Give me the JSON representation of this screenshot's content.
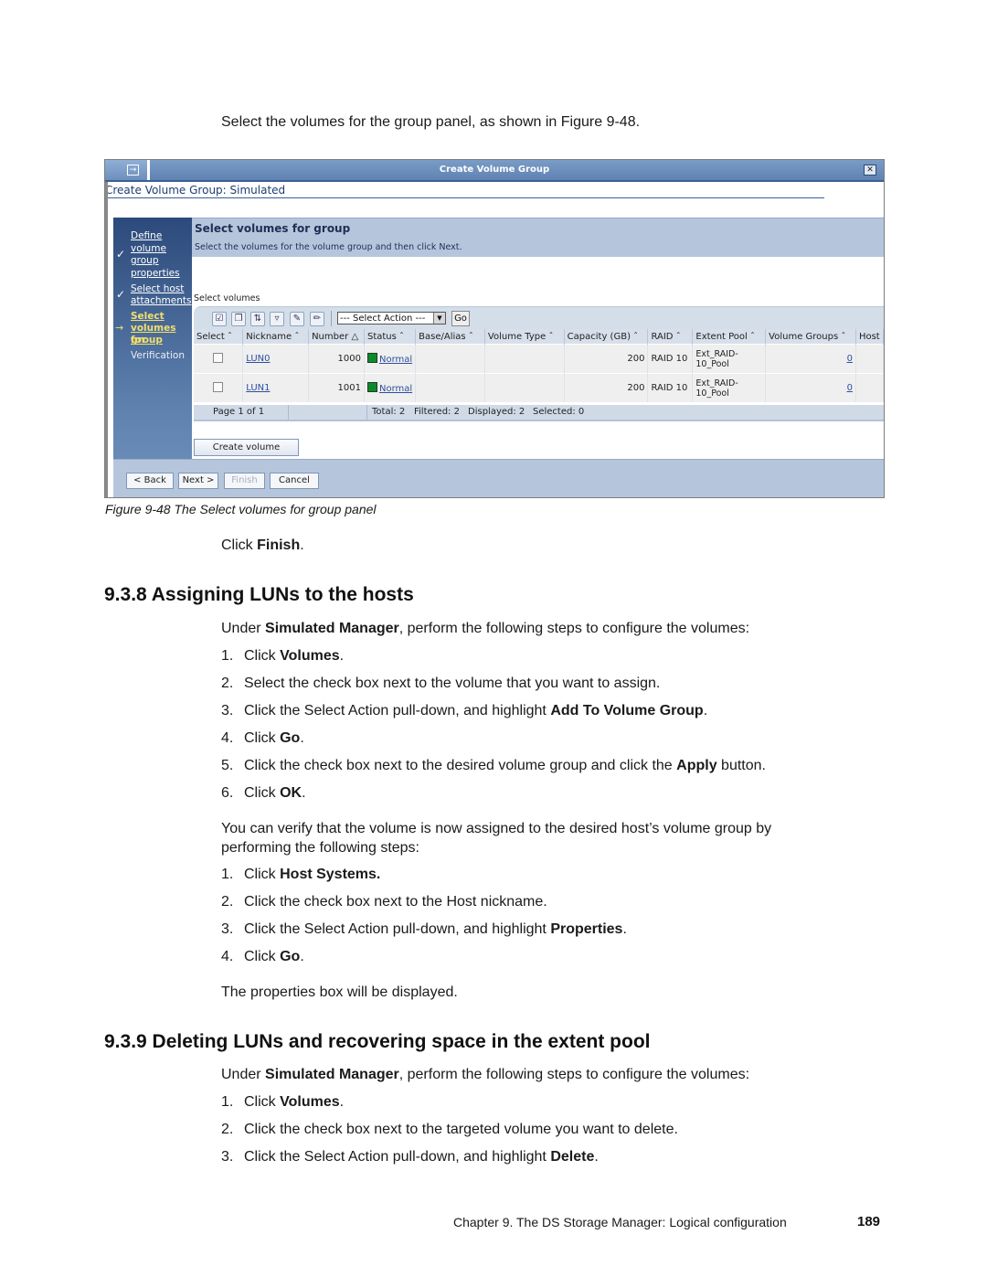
{
  "intro": "Select the volumes for the group panel, as shown in Figure 9-48.",
  "figure": {
    "window_title": "Create Volume Group",
    "wizard_title": "Create Volume Group: Simulated",
    "nav": {
      "step1": [
        "Define",
        "volume",
        "group",
        "properties"
      ],
      "step2": [
        "Select host",
        "attachments"
      ],
      "step3": [
        "Select",
        "volumes for",
        "group"
      ],
      "step4": "Verification"
    },
    "panel_heading": "Select volumes for group",
    "panel_subtext": "Select the volumes for the volume group and then click Next.",
    "select_volumes_label": "Select volumes",
    "toolbar": {
      "icons": [
        "select-all-icon",
        "deselect-all-icon",
        "show-filter-icon",
        "clear-filter-icon",
        "edit-sort-icon",
        "clear-sort-icon"
      ],
      "select_action": "--- Select Action ---",
      "go": "Go"
    },
    "columns": [
      "Select",
      "Nickname",
      "Number",
      "Status",
      "Base/Alias",
      "Volume Type",
      "Capacity (GB)",
      "RAID",
      "Extent Pool",
      "Volume Groups",
      "Host"
    ],
    "rows": [
      {
        "nickname": "LUN0",
        "number": "1000",
        "status": "Normal",
        "base_alias": "",
        "volume_type": "",
        "capacity": "200",
        "raid": "RAID 10",
        "pool_line1": "Ext_RAID-",
        "pool_line2": "10_Pool",
        "volume_groups": "0"
      },
      {
        "nickname": "LUN1",
        "number": "1001",
        "status": "Normal",
        "base_alias": "",
        "volume_type": "",
        "capacity": "200",
        "raid": "RAID 10",
        "pool_line1": "Ext_RAID-",
        "pool_line2": "10_Pool",
        "volume_groups": "0"
      }
    ],
    "pager": {
      "page": "Page 1 of 1",
      "total": "Total: 2",
      "filtered": "Filtered: 2",
      "displayed": "Displayed: 2",
      "selected": "Selected: 0"
    },
    "create_volume": "Create volume",
    "buttons": {
      "back": "< Back",
      "next": "Next >",
      "finish": "Finish",
      "cancel": "Cancel"
    },
    "caption": "Figure 9-48   The Select volumes for group panel"
  },
  "click_finish": {
    "pre": "Click ",
    "bold": "Finish",
    "post": "."
  },
  "section1": {
    "heading": "9.3.8  Assigning LUNs to the hosts",
    "intro": {
      "pre": "Under ",
      "bold": "Simulated Manager",
      "post": ", perform the following steps to configure the volumes:"
    },
    "steps": [
      {
        "num": "1.",
        "pre": "Click ",
        "bold": "Volumes",
        "post": "."
      },
      {
        "num": "2.",
        "pre": "Select the check box next to the volume that you want to assign.",
        "bold": "",
        "post": ""
      },
      {
        "num": "3.",
        "pre": "Click the Select Action pull-down, and highlight ",
        "bold": "Add To Volume Group",
        "post": "."
      },
      {
        "num": "4.",
        "pre": "Click ",
        "bold": "Go",
        "post": "."
      },
      {
        "num": "5.",
        "pre": "Click the check box next to the desired volume group and click the ",
        "bold": "Apply",
        "post": " button."
      },
      {
        "num": "6.",
        "pre": "Click ",
        "bold": "OK",
        "post": "."
      }
    ],
    "verify_line1": "You can verify that the volume is now assigned to the desired host’s volume group by",
    "verify_line2": "performing the following steps:",
    "verify_steps": [
      {
        "num": "1.",
        "pre": "Click ",
        "bold": "Host Systems.",
        "post": ""
      },
      {
        "num": "2.",
        "pre": "Click the check box next to the Host nickname.",
        "bold": "",
        "post": ""
      },
      {
        "num": "3.",
        "pre": "Click the Select Action pull-down, and highlight ",
        "bold": "Properties",
        "post": "."
      },
      {
        "num": "4.",
        "pre": "Click ",
        "bold": "Go",
        "post": "."
      }
    ],
    "closing": "The properties box will be displayed."
  },
  "section2": {
    "heading": "9.3.9  Deleting LUNs and recovering space in the extent pool",
    "intro": {
      "pre": "Under ",
      "bold": "Simulated Manager",
      "post": ", perform the following steps to configure the volumes:"
    },
    "steps": [
      {
        "num": "1.",
        "pre": "Click ",
        "bold": "Volumes",
        "post": "."
      },
      {
        "num": "2.",
        "pre": "Click the check box next to the targeted volume you want to delete.",
        "bold": "",
        "post": ""
      },
      {
        "num": "3.",
        "pre": "Click the Select Action pull-down, and highlight ",
        "bold": "Delete",
        "post": "."
      }
    ]
  },
  "footer": {
    "chapter": "Chapter 9. The DS Storage Manager: Logical configuration",
    "page": "189"
  }
}
